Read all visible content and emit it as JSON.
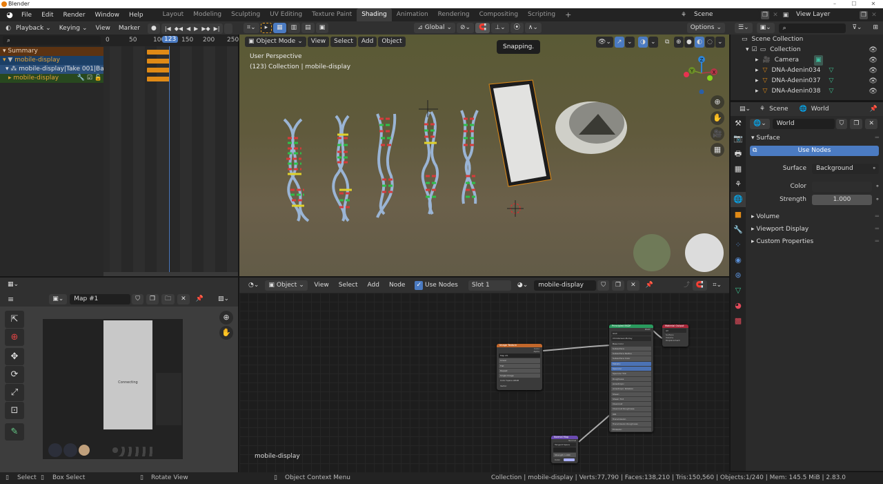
{
  "window": {
    "title": "Blender",
    "minimize": "–",
    "maximize": "☐",
    "close": "✕"
  },
  "topbar": {
    "menus": [
      "File",
      "Edit",
      "Render",
      "Window",
      "Help"
    ],
    "workspaces": [
      "Layout",
      "Modeling",
      "Sculpting",
      "UV Editing",
      "Texture Paint",
      "Shading",
      "Animation",
      "Rendering",
      "Compositing",
      "Scripting"
    ],
    "active_workspace": "Shading",
    "add_workspace": "+",
    "scene": "Scene",
    "view_layer": "View Layer"
  },
  "dopesheet": {
    "menus": {
      "playback": "Playback",
      "keying": "Keying",
      "view": "View",
      "marker": "Marker"
    },
    "current_frame": "123",
    "frame_ticks": [
      "0",
      "50",
      "100",
      "150",
      "200",
      "250"
    ],
    "rows": [
      {
        "label": "Summary",
        "type": "summary"
      },
      {
        "label": "mobile-display",
        "type": "object"
      },
      {
        "label": "mobile-display|Take 001|Base",
        "type": "action"
      },
      {
        "label": "mobile-display",
        "type": "channel"
      }
    ]
  },
  "viewport": {
    "mode": "Object Mode",
    "menus": [
      "View",
      "Select",
      "Add",
      "Object"
    ],
    "orientation": "Global",
    "options": "Options",
    "perspective": "User Perspective",
    "collection_info": "(123) Collection | mobile-display",
    "tooltip": "Snapping.",
    "gizmo": {
      "x": "X",
      "y": "Y",
      "z": "Z"
    },
    "accent_color": "#4b7bc2"
  },
  "outliner": {
    "root": "Scene Collection",
    "items": [
      {
        "label": "Collection",
        "icon": "collection-icon"
      },
      {
        "label": "Camera",
        "icon": "camera-icon"
      },
      {
        "label": "DNA-Adenin034",
        "icon": "mesh-icon"
      },
      {
        "label": "DNA-Adenin037",
        "icon": "mesh-icon"
      },
      {
        "label": "DNA-Adenin038",
        "icon": "mesh-icon"
      }
    ]
  },
  "properties": {
    "breadcrumb": {
      "scene": "Scene",
      "world": "World"
    },
    "world_name": "World",
    "surface_section": "Surface",
    "use_nodes": "Use Nodes",
    "surface_label": "Surface",
    "surface_value": "Background",
    "color_label": "Color",
    "strength_label": "Strength",
    "strength_value": "1.000",
    "collapsed_sections": [
      "Volume",
      "Viewport Display",
      "Custom Properties"
    ]
  },
  "image_editor": {
    "image_name": "Map #1",
    "overlay_text": "Connecting"
  },
  "node_editor": {
    "object_type": "Object",
    "menus": [
      "View",
      "Select",
      "Add",
      "Node"
    ],
    "use_nodes_label": "Use Nodes",
    "use_nodes_checked": true,
    "slot": "Slot 1",
    "material": "mobile-display",
    "footer_label": "mobile-display",
    "nodes": {
      "image_texture": {
        "title": "Image Texture",
        "outputs": [
          "Color",
          "Alpha"
        ],
        "image": "Map #1",
        "rows": [
          "Linear",
          "Flat",
          "Repeat",
          "Single Image"
        ],
        "colorspace_label": "Color Space",
        "colorspace": "sRGB",
        "vector": "Vector"
      },
      "principled": {
        "title": "Principled BSDF",
        "output": "BSDF",
        "dist": "GGX",
        "sss_method": "Christensen-Burley",
        "inputs": [
          "Base Color",
          "Subsurface",
          "Subsurface Radius",
          "Subsurface Color",
          "Metallic",
          "Specular",
          "Specular Tint",
          "Roughness",
          "Anisotropic",
          "Anisotropic Rotation",
          "Sheen",
          "Sheen Tint",
          "Clearcoat",
          "Clearcoat Roughness",
          "IOR",
          "Transmission",
          "Transmission Roughness",
          "Emission",
          "Alpha",
          "Normal",
          "Clearcoat Normal",
          "Tangent"
        ]
      },
      "material_output": {
        "title": "Material Output",
        "target": "All",
        "inputs": [
          "Surface",
          "Volume",
          "Displacement"
        ]
      },
      "normal_map": {
        "title": "Normal Map",
        "output": "Normal",
        "space": "Tangent Space",
        "strength_label": "Strength",
        "strength": "1.000",
        "color": "Color"
      }
    }
  },
  "statusbar": {
    "select": "Select",
    "box_select": "Box Select",
    "rotate_view": "Rotate View",
    "context_menu": "Object Context Menu",
    "stats": "Collection | mobile-display | Verts:77,790 | Faces:138,210 | Tris:150,560 | Objects:1/240 | Mem: 145.5 MiB | 2.83.0"
  }
}
